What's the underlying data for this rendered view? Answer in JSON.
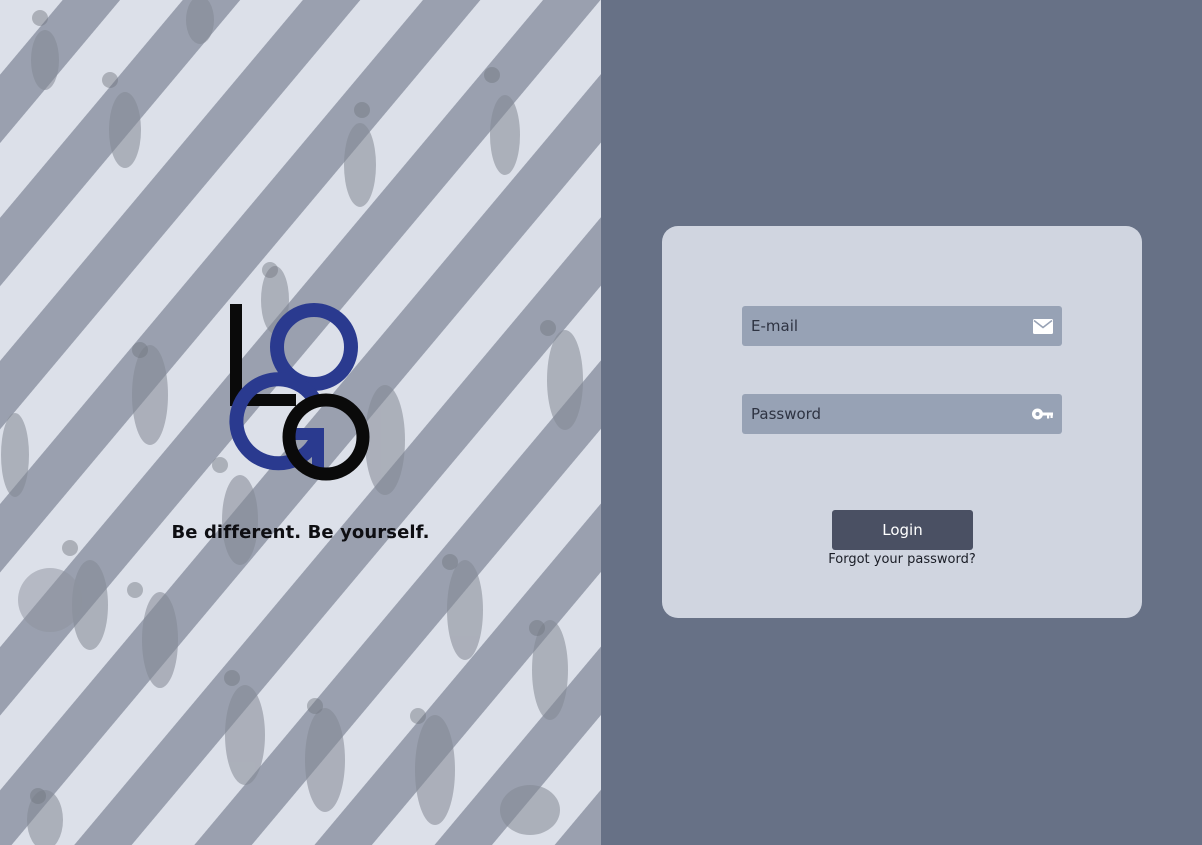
{
  "brand": {
    "logo_text": "LOGO",
    "tagline": "Be different. Be yourself."
  },
  "login_form": {
    "email": {
      "placeholder": "E-mail",
      "value": "",
      "icon": "envelope-icon"
    },
    "password": {
      "placeholder": "Password",
      "value": "",
      "icon": "key-icon"
    },
    "login_label": "Login",
    "forgot_label": "Forgot your password?"
  },
  "colors": {
    "right_panel_bg": "#677186",
    "card_bg": "#d0d5e0",
    "input_bg": "#97a2b5",
    "button_bg": "#4a5063",
    "logo_blue": "#2a3a8f",
    "logo_black": "#0a0a0a"
  }
}
